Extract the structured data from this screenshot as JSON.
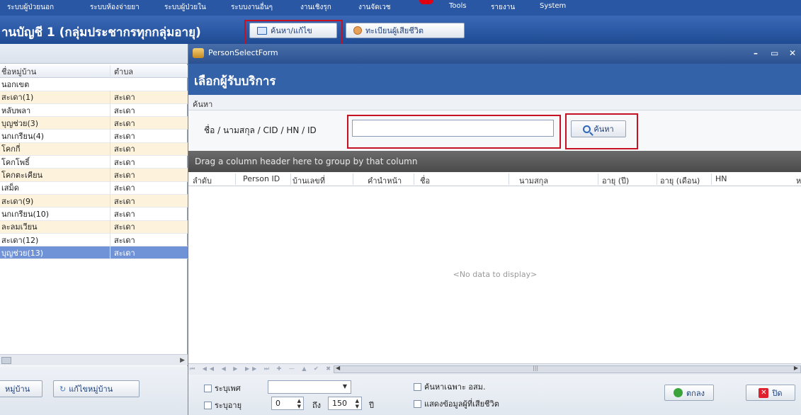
{
  "menu": {
    "items": [
      "ระบบผู้ป่วยนอก",
      "ระบบห้องจ่ายยา",
      "ระบบผู้ป่วยใน",
      "ระบบงานอื่นๆ",
      "งานเชิงรุก",
      "งานจัดเวช",
      "Tools",
      "รายงาน",
      "System"
    ]
  },
  "subheader": {
    "title": "านบัญชี 1 (กลุ่มประชากรทุกกลุ่มอายุ)",
    "search_edit_label": "ค้นหา/แก้ไข",
    "deceased_label": "ทะเบียนผู้เสียชีวิต"
  },
  "left_panel": {
    "columns": [
      "ชื่อหมู่บ้าน",
      "ตำบล"
    ],
    "rows": [
      {
        "village": "นอกเขต",
        "subdistrict": ""
      },
      {
        "village": "สะเดา(1)",
        "subdistrict": "สะเดา"
      },
      {
        "village": "หลับพลา",
        "subdistrict": "สะเดา"
      },
      {
        "village": "บุญช่วย(3)",
        "subdistrict": "สะเดา"
      },
      {
        "village": "นกเกรียน(4)",
        "subdistrict": "สะเดา"
      },
      {
        "village": "โคกกี่",
        "subdistrict": "สะเดา"
      },
      {
        "village": "โคกโพธิ์",
        "subdistrict": "สะเดา"
      },
      {
        "village": "โคกตะเคียน",
        "subdistrict": "สะเดา"
      },
      {
        "village": "เสม็ด",
        "subdistrict": "สะเดา"
      },
      {
        "village": "สะเดา(9)",
        "subdistrict": "สะเดา"
      },
      {
        "village": "นกเกรียน(10)",
        "subdistrict": "สะเดา"
      },
      {
        "village": "ละลมเวียน",
        "subdistrict": "สะเดา"
      },
      {
        "village": "สะเดา(12)",
        "subdistrict": "สะเดา"
      },
      {
        "village": "บุญช่วย(13)",
        "subdistrict": "สะเดา"
      }
    ],
    "selected_row": 13,
    "add_village_label": "หมู่บ้าน",
    "edit_village_label": "แก้ไขหมู่บ้าน"
  },
  "dialog": {
    "window_title": "PersonSelectForm",
    "heading": "เลือกผู้รับบริการ",
    "search_caption": "ค้นหา",
    "search_label": "ชื่อ / นามสกุล / CID / HN / ID",
    "search_value": "",
    "search_button_label": "ค้นหา",
    "group_hint": "Drag a column header here to group by that column",
    "columns": [
      "ลำดับ",
      "Person ID",
      "บ้านเลขที่",
      "คำนำหน้า",
      "ชื่อ",
      "นามสกุล",
      "อายุ (ปี)",
      "อายุ (เดือน)",
      "HN",
      "ห"
    ],
    "empty_text": "<No data to display>",
    "footer": {
      "gender_label": "ระบุเพศ",
      "age_label": "ระบุอายุ",
      "age_from": "0",
      "to_label": "ถึง",
      "age_to": "150",
      "unit_label": "ปี",
      "vhv_only_label": "ค้นหาเฉพาะ อสม.",
      "show_deceased_label": "แสดงข้อมูลผู้ที่เสียชีวิต",
      "ok_label": "ตกลง",
      "close_label": "ปิด"
    }
  },
  "colors": {
    "menu_bg": "#2a57a3",
    "banner_bg": "#3462a8",
    "highlight": "#c41224",
    "selected_row": "#6f93d6",
    "alt_row": "#fdf3dc"
  }
}
